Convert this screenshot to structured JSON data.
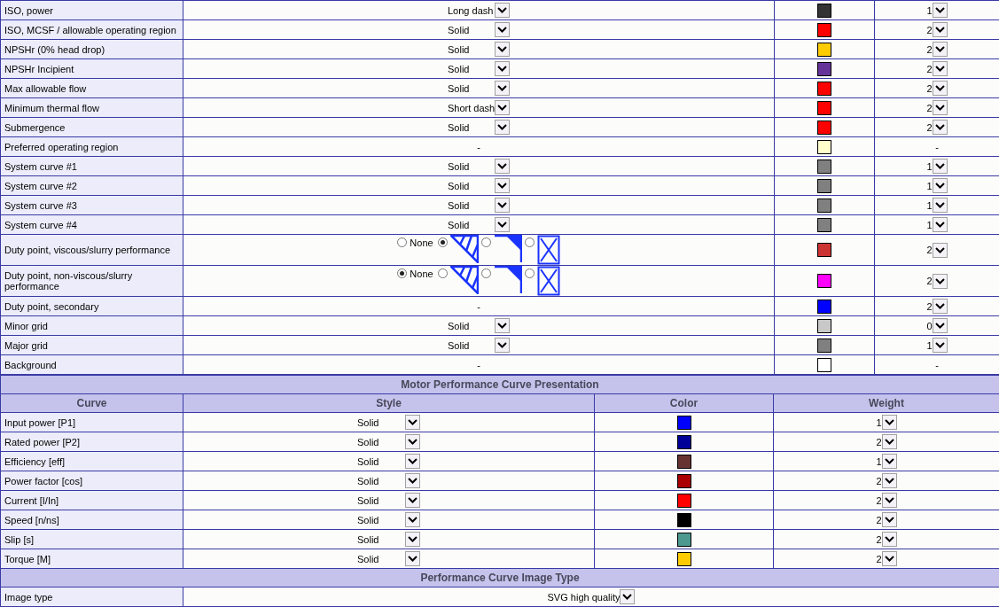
{
  "pump_curves": {
    "rows": [
      {
        "curve": "ISO, power",
        "style": {
          "kind": "dropdown",
          "value": "Long dash"
        },
        "color": "#333333",
        "weight": {
          "kind": "dropdown",
          "value": "1"
        }
      },
      {
        "curve": "ISO, MCSF / allowable operating region",
        "style": {
          "kind": "dropdown",
          "value": "Solid"
        },
        "color": "#ff0000",
        "weight": {
          "kind": "dropdown",
          "value": "2"
        }
      },
      {
        "curve": "NPSHr (0% head drop)",
        "style": {
          "kind": "dropdown",
          "value": "Solid"
        },
        "color": "#ffcc00",
        "weight": {
          "kind": "dropdown",
          "value": "2"
        }
      },
      {
        "curve": "NPSHr Incipient",
        "style": {
          "kind": "dropdown",
          "value": "Solid"
        },
        "color": "#663399",
        "weight": {
          "kind": "dropdown",
          "value": "2"
        }
      },
      {
        "curve": "Max allowable flow",
        "style": {
          "kind": "dropdown",
          "value": "Solid"
        },
        "color": "#ff0000",
        "weight": {
          "kind": "dropdown",
          "value": "2"
        }
      },
      {
        "curve": "Minimum thermal flow",
        "style": {
          "kind": "dropdown",
          "value": "Short dash"
        },
        "color": "#ff0000",
        "weight": {
          "kind": "dropdown",
          "value": "2"
        }
      },
      {
        "curve": "Submergence",
        "style": {
          "kind": "dropdown",
          "value": "Solid"
        },
        "color": "#ff0000",
        "weight": {
          "kind": "dropdown",
          "value": "2"
        }
      },
      {
        "curve": "Preferred operating region",
        "style": {
          "kind": "none",
          "value": "-"
        },
        "color": "#ffffcc",
        "weight": {
          "kind": "none",
          "value": "-"
        }
      },
      {
        "curve": "System curve #1",
        "style": {
          "kind": "dropdown",
          "value": "Solid"
        },
        "color": "#808080",
        "weight": {
          "kind": "dropdown",
          "value": "1"
        }
      },
      {
        "curve": "System curve #2",
        "style": {
          "kind": "dropdown",
          "value": "Solid"
        },
        "color": "#808080",
        "weight": {
          "kind": "dropdown",
          "value": "1"
        }
      },
      {
        "curve": "System curve #3",
        "style": {
          "kind": "dropdown",
          "value": "Solid"
        },
        "color": "#808080",
        "weight": {
          "kind": "dropdown",
          "value": "1"
        }
      },
      {
        "curve": "System curve #4",
        "style": {
          "kind": "dropdown",
          "value": "Solid"
        },
        "color": "#808080",
        "weight": {
          "kind": "dropdown",
          "value": "1"
        }
      },
      {
        "curve": "Duty point, viscous/slurry performance",
        "style": {
          "kind": "markers",
          "options": [
            {
              "kind": "none",
              "label": "None",
              "selected": false
            },
            {
              "kind": "hatched-triangle",
              "selected": true
            },
            {
              "kind": "corner",
              "selected": false
            },
            {
              "kind": "crossed-box",
              "selected": false
            }
          ]
        },
        "color": "#cc3333",
        "weight": {
          "kind": "dropdown",
          "value": "2"
        }
      },
      {
        "curve": "Duty point, non-viscous/slurry performance",
        "style": {
          "kind": "markers",
          "options": [
            {
              "kind": "none",
              "label": "None",
              "selected": true
            },
            {
              "kind": "hatched-triangle",
              "selected": false
            },
            {
              "kind": "corner",
              "selected": false
            },
            {
              "kind": "crossed-box",
              "selected": false
            }
          ]
        },
        "color": "#ff00ff",
        "weight": {
          "kind": "dropdown",
          "value": "2"
        }
      },
      {
        "curve": "Duty point, secondary",
        "style": {
          "kind": "none",
          "value": "-"
        },
        "color": "#0000ff",
        "weight": {
          "kind": "dropdown",
          "value": "2"
        }
      },
      {
        "curve": "Minor grid",
        "style": {
          "kind": "dropdown",
          "value": "Solid"
        },
        "color": "#c8c8c8",
        "weight": {
          "kind": "dropdown",
          "value": "0"
        }
      },
      {
        "curve": "Major grid",
        "style": {
          "kind": "dropdown",
          "value": "Solid"
        },
        "color": "#808080",
        "weight": {
          "kind": "dropdown",
          "value": "1"
        }
      },
      {
        "curve": "Background",
        "style": {
          "kind": "none",
          "value": "-"
        },
        "color": "#ffffff",
        "weight": {
          "kind": "none",
          "value": "-"
        }
      }
    ]
  },
  "motor_section": {
    "title": "Motor Performance Curve Presentation",
    "columns": [
      "Curve",
      "Style",
      "Color",
      "Weight"
    ],
    "rows": [
      {
        "curve": "Input power [P1]",
        "style": {
          "kind": "dropdown",
          "value": "Solid"
        },
        "color": "#0000ff",
        "weight": {
          "kind": "dropdown",
          "value": "1"
        }
      },
      {
        "curve": "Rated power [P2]",
        "style": {
          "kind": "dropdown",
          "value": "Solid"
        },
        "color": "#000099",
        "weight": {
          "kind": "dropdown",
          "value": "2"
        }
      },
      {
        "curve": "Efficiency [eff]",
        "style": {
          "kind": "dropdown",
          "value": "Solid"
        },
        "color": "#663333",
        "weight": {
          "kind": "dropdown",
          "value": "1"
        }
      },
      {
        "curve": "Power factor [cos]",
        "style": {
          "kind": "dropdown",
          "value": "Solid"
        },
        "color": "#aa0000",
        "weight": {
          "kind": "dropdown",
          "value": "2"
        }
      },
      {
        "curve": "Current [I/In]",
        "style": {
          "kind": "dropdown",
          "value": "Solid"
        },
        "color": "#ff0000",
        "weight": {
          "kind": "dropdown",
          "value": "2"
        }
      },
      {
        "curve": "Speed [n/ns]",
        "style": {
          "kind": "dropdown",
          "value": "Solid"
        },
        "color": "#000000",
        "weight": {
          "kind": "dropdown",
          "value": "2"
        }
      },
      {
        "curve": "Slip [s]",
        "style": {
          "kind": "dropdown",
          "value": "Solid"
        },
        "color": "#4d9990",
        "weight": {
          "kind": "dropdown",
          "value": "2"
        }
      },
      {
        "curve": "Torque [M]",
        "style": {
          "kind": "dropdown",
          "value": "Solid"
        },
        "color": "#ffcc00",
        "weight": {
          "kind": "dropdown",
          "value": "2"
        }
      }
    ]
  },
  "image_section": {
    "title": "Performance Curve Image Type",
    "rows": [
      {
        "label": "Image type",
        "value": "SVG high quality"
      }
    ]
  }
}
